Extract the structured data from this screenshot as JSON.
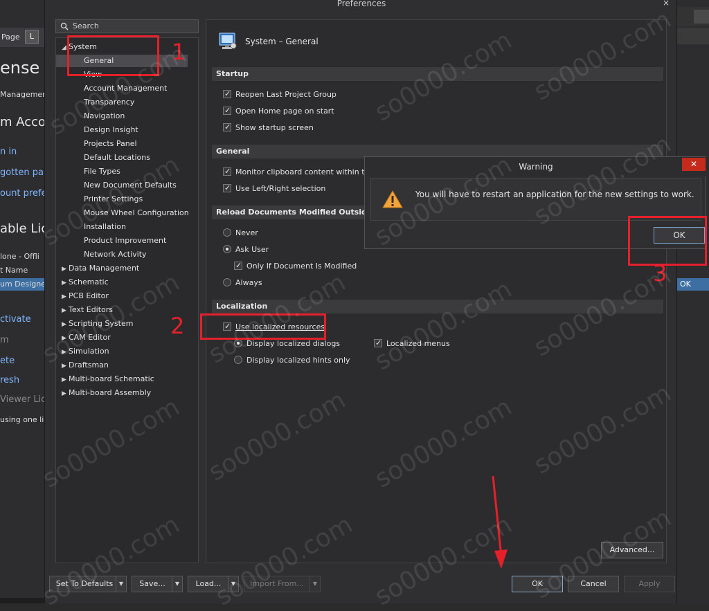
{
  "background_app": {
    "tab_label": "Page",
    "tab_icon_letter": "L",
    "lines": [
      {
        "text": "ense M",
        "cls": "big"
      },
      {
        "text": "Managemen",
        "cls": "small"
      },
      {
        "text": "m Accou",
        "cls": "med"
      },
      {
        "text": "n in",
        "cls": "link"
      },
      {
        "text": "gotten pass",
        "cls": "link"
      },
      {
        "text": "ount prefer",
        "cls": "link"
      },
      {
        "text": "able Lic",
        "cls": "med"
      },
      {
        "text": "lone - Offli",
        "cls": "small"
      },
      {
        "text": "t Name",
        "cls": "small"
      },
      {
        "text": "um Designer",
        "cls": "small"
      },
      {
        "text": "ctivate",
        "cls": "link"
      },
      {
        "text": "m",
        "cls": "dim"
      },
      {
        "text": "ete",
        "cls": "link"
      },
      {
        "text": "resh",
        "cls": "link"
      },
      {
        "text": "Viewer Lic",
        "cls": "dim"
      },
      {
        "text": "using one li",
        "cls": "small"
      }
    ],
    "right_ok": "OK"
  },
  "prefs": {
    "title": "Preferences",
    "close": "×",
    "search_placeholder": "Search",
    "tree": [
      {
        "label": "System",
        "indent": 0,
        "arrow": "◢",
        "selected": false
      },
      {
        "label": "General",
        "indent": 1,
        "arrow": "",
        "selected": true
      },
      {
        "label": "View",
        "indent": 1,
        "arrow": "",
        "selected": false
      },
      {
        "label": "Account Management",
        "indent": 1,
        "arrow": "",
        "selected": false
      },
      {
        "label": "Transparency",
        "indent": 1,
        "arrow": "",
        "selected": false
      },
      {
        "label": "Navigation",
        "indent": 1,
        "arrow": "",
        "selected": false
      },
      {
        "label": "Design Insight",
        "indent": 1,
        "arrow": "",
        "selected": false
      },
      {
        "label": "Projects Panel",
        "indent": 1,
        "arrow": "",
        "selected": false
      },
      {
        "label": "Default Locations",
        "indent": 1,
        "arrow": "",
        "selected": false
      },
      {
        "label": "File Types",
        "indent": 1,
        "arrow": "",
        "selected": false
      },
      {
        "label": "New Document Defaults",
        "indent": 1,
        "arrow": "",
        "selected": false
      },
      {
        "label": "Printer Settings",
        "indent": 1,
        "arrow": "",
        "selected": false
      },
      {
        "label": "Mouse Wheel Configuration",
        "indent": 1,
        "arrow": "",
        "selected": false
      },
      {
        "label": "Installation",
        "indent": 1,
        "arrow": "",
        "selected": false
      },
      {
        "label": "Product Improvement",
        "indent": 1,
        "arrow": "",
        "selected": false
      },
      {
        "label": "Network Activity",
        "indent": 1,
        "arrow": "",
        "selected": false
      },
      {
        "label": "Data Management",
        "indent": 0,
        "arrow": "▶",
        "selected": false
      },
      {
        "label": "Schematic",
        "indent": 0,
        "arrow": "▶",
        "selected": false
      },
      {
        "label": "PCB Editor",
        "indent": 0,
        "arrow": "▶",
        "selected": false
      },
      {
        "label": "Text Editors",
        "indent": 0,
        "arrow": "▶",
        "selected": false
      },
      {
        "label": "Scripting System",
        "indent": 0,
        "arrow": "▶",
        "selected": false
      },
      {
        "label": "CAM Editor",
        "indent": 0,
        "arrow": "▶",
        "selected": false
      },
      {
        "label": "Simulation",
        "indent": 0,
        "arrow": "▶",
        "selected": false
      },
      {
        "label": "Draftsman",
        "indent": 0,
        "arrow": "▶",
        "selected": false
      },
      {
        "label": "Multi-board Schematic",
        "indent": 0,
        "arrow": "▶",
        "selected": false
      },
      {
        "label": "Multi-board Assembly",
        "indent": 0,
        "arrow": "▶",
        "selected": false
      }
    ],
    "page_title": "System – General",
    "sections": {
      "startup": "Startup",
      "general": "General",
      "reload": "Reload Documents Modified Outside of A",
      "localization": "Localization"
    },
    "startup_opts": [
      {
        "label": "Reopen Last Project Group",
        "checked": true
      },
      {
        "label": "Open Home page on start",
        "checked": true
      },
      {
        "label": "Show startup screen",
        "checked": true
      }
    ],
    "general_opts": [
      {
        "label": "Monitor clipboard content within th",
        "checked": true
      },
      {
        "label": "Use Left/Right selection",
        "checked": true
      }
    ],
    "reload_opts": {
      "never": "Never",
      "ask_user": "Ask User",
      "only_if_modified": "Only If Document Is Modified",
      "always": "Always"
    },
    "localization_opts": {
      "use_localized": "Use localized resources",
      "display_dialogs": "Display localized dialogs",
      "localized_menus": "Localized menus",
      "display_hints": "Display localized hints only"
    },
    "advanced": "Advanced...",
    "footer": {
      "set_defaults": "Set To Defaults",
      "save": "Save...",
      "load": "Load...",
      "import_from": "Import From...",
      "ok": "OK",
      "cancel": "Cancel",
      "apply": "Apply"
    }
  },
  "warning": {
    "title": "Warning",
    "close": "✕",
    "message": "You will have to restart an application for the new settings to work.",
    "ok": "OK"
  },
  "annotations": {
    "n1": "1",
    "n2": "2",
    "n3": "3"
  },
  "watermark": "so0000.com",
  "colors": {
    "annotation_red": "#e5202a",
    "close_red": "#c42b1c",
    "warning_yellow": "#f2a33a"
  }
}
